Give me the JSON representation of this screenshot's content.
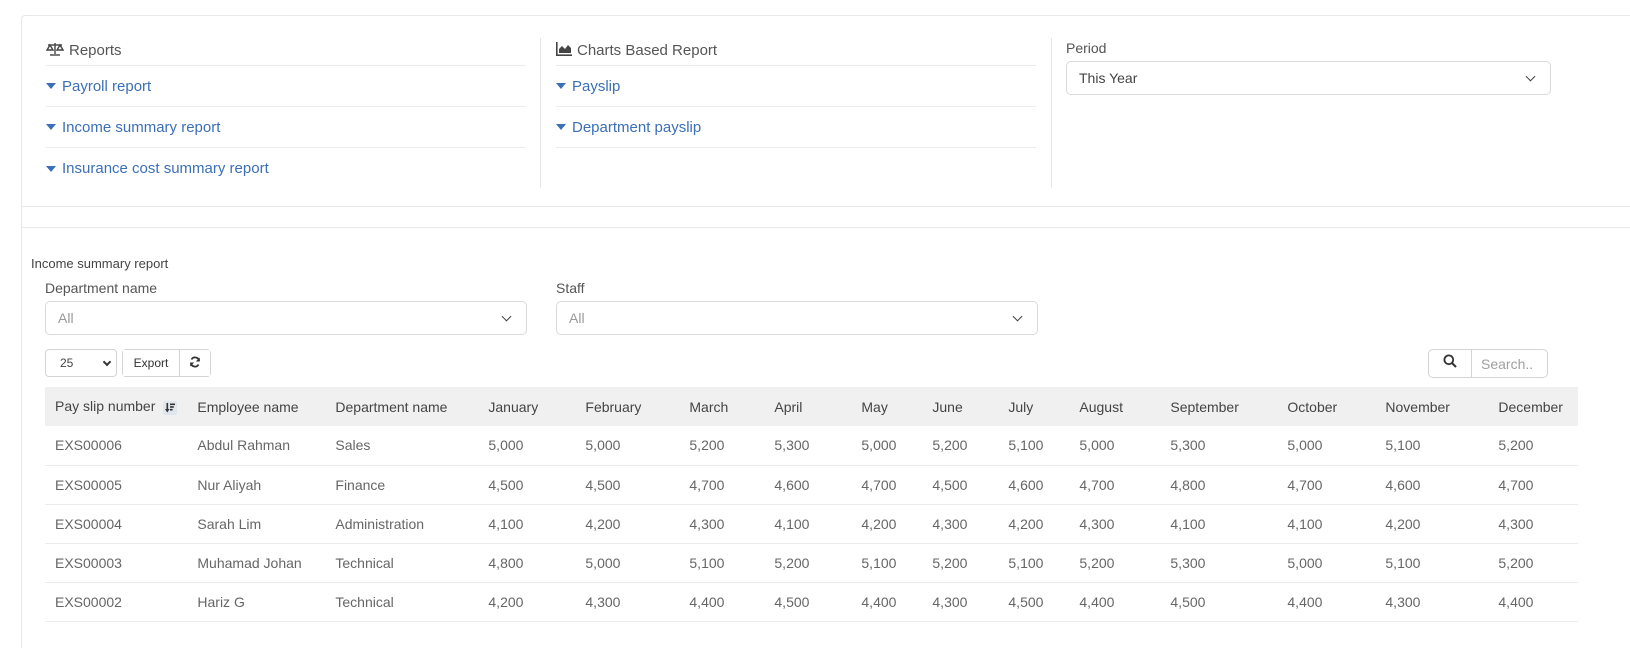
{
  "reports": {
    "heading": "Reports",
    "icon": "balance-scale-icon",
    "links": [
      "Payroll report",
      "Income summary report",
      "Insurance cost summary report"
    ]
  },
  "charts": {
    "heading": "Charts Based Report",
    "icon": "area-chart-icon",
    "links": [
      "Payslip",
      "Department payslip"
    ]
  },
  "period": {
    "label": "Period",
    "value": "This Year"
  },
  "income_report": {
    "title": "Income summary report",
    "filters": {
      "department": {
        "label": "Department name",
        "value": "All"
      },
      "staff": {
        "label": "Staff",
        "value": "All"
      }
    },
    "toolbar": {
      "page_length": "25",
      "export_label": "Export",
      "refresh_icon": "refresh-icon",
      "search_icon": "search-icon",
      "search_placeholder": "Search.."
    },
    "table": {
      "columns": [
        "Pay slip number",
        "Employee name",
        "Department name",
        "January",
        "February",
        "March",
        "April",
        "May",
        "June",
        "July",
        "August",
        "September",
        "October",
        "November",
        "December"
      ],
      "sorted_column": "Pay slip number",
      "rows": [
        [
          "EXS00006",
          "Abdul Rahman",
          "Sales",
          "5,000",
          "5,000",
          "5,200",
          "5,300",
          "5,000",
          "5,200",
          "5,100",
          "5,000",
          "5,300",
          "5,000",
          "5,100",
          "5,200"
        ],
        [
          "EXS00005",
          "Nur Aliyah",
          "Finance",
          "4,500",
          "4,500",
          "4,700",
          "4,600",
          "4,700",
          "4,500",
          "4,600",
          "4,700",
          "4,800",
          "4,700",
          "4,600",
          "4,700"
        ],
        [
          "EXS00004",
          "Sarah Lim",
          "Administration",
          "4,100",
          "4,200",
          "4,300",
          "4,100",
          "4,200",
          "4,300",
          "4,200",
          "4,300",
          "4,100",
          "4,100",
          "4,200",
          "4,300"
        ],
        [
          "EXS00003",
          "Muhamad Johan",
          "Technical",
          "4,800",
          "5,000",
          "5,100",
          "5,200",
          "5,100",
          "5,200",
          "5,100",
          "5,200",
          "5,300",
          "5,000",
          "5,100",
          "5,200"
        ],
        [
          "EXS00002",
          "Hariz G",
          "Technical",
          "4,200",
          "4,300",
          "4,400",
          "4,500",
          "4,400",
          "4,300",
          "4,500",
          "4,400",
          "4,500",
          "4,400",
          "4,300",
          "4,400"
        ]
      ]
    }
  },
  "colors": {
    "link": "#3b6fb8",
    "header_bg": "#f0f0f0"
  }
}
